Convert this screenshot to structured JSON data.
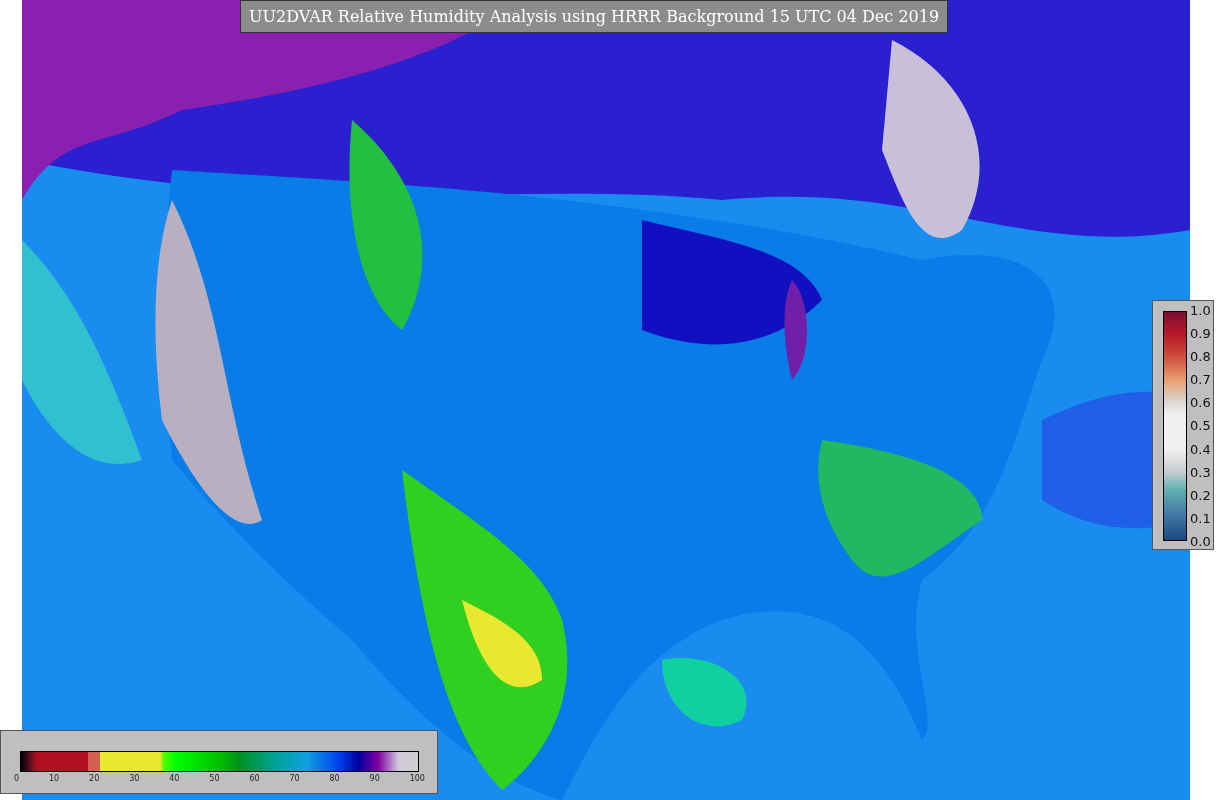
{
  "title": "UU2DVAR Relative Humidity Analysis using HRRR Background 15 UTC 04 Dec 2019",
  "humidity_colorbar": {
    "ticks": [
      "0",
      "10",
      "20",
      "30",
      "40",
      "50",
      "60",
      "70",
      "80",
      "90",
      "100"
    ]
  },
  "ratio_colorbar": {
    "ticks": [
      "1.0",
      "0.9",
      "0.8",
      "0.7",
      "0.6",
      "0.5",
      "0.4",
      "0.3",
      "0.2",
      "0.1",
      "0.0"
    ]
  }
}
